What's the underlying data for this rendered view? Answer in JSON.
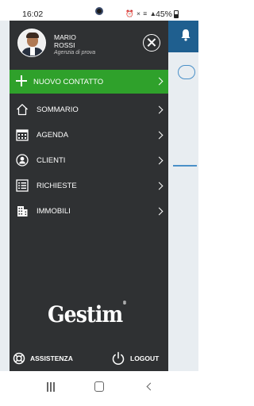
{
  "status_bar": {
    "time": "16:02",
    "icons": "⏰ × ≡ ▲",
    "battery": "45%"
  },
  "profile": {
    "first_name": "MARIO",
    "last_name": "ROSSI",
    "agency": "Agenzia di prova"
  },
  "new_contact": {
    "label": "NUOVO CONTATTO"
  },
  "menu": [
    {
      "label": "SOMMARIO",
      "icon": "home-icon"
    },
    {
      "label": "AGENDA",
      "icon": "calendar-icon"
    },
    {
      "label": "CLIENTI",
      "icon": "person-icon"
    },
    {
      "label": "RICHIESTE",
      "icon": "list-icon"
    },
    {
      "label": "IMMOBILI",
      "icon": "building-icon"
    }
  ],
  "logo": {
    "text": "Gestim",
    "mark": "®"
  },
  "footer": {
    "assistance": "ASSISTENZA",
    "logout": "LOGOUT"
  },
  "colors": {
    "drawer_bg": "#2f3133",
    "accent_green": "#2fa12b",
    "header_blue": "#1f5f8f"
  }
}
